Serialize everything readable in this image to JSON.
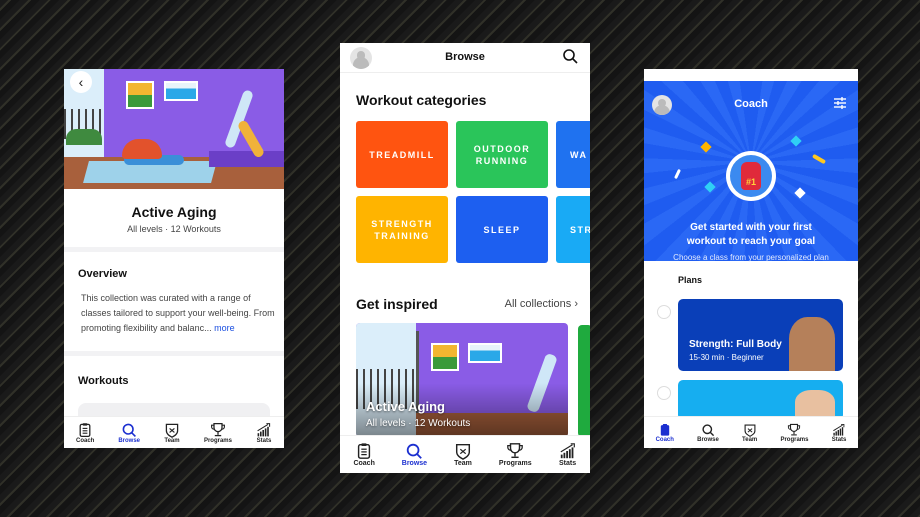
{
  "tabs": [
    {
      "label": "Coach",
      "icon": "clipboard-icon"
    },
    {
      "label": "Browse",
      "icon": "search-icon"
    },
    {
      "label": "Team",
      "icon": "team-shield-icon"
    },
    {
      "label": "Programs",
      "icon": "trophy-icon"
    },
    {
      "label": "Stats",
      "icon": "stats-chart-icon"
    }
  ],
  "collection": {
    "title": "Active Aging",
    "subtitle": "All levels · 12 Workouts",
    "overview_heading": "Overview",
    "overview_text": "This collection was curated with a range of classes tailored to support your well-being. From promoting flexibility and balanc...",
    "more_link": "more",
    "workouts_heading": "Workouts",
    "active_tab": "Browse"
  },
  "browse": {
    "header_title": "Browse",
    "categories_heading": "Workout categories",
    "categories": [
      {
        "label": "TREADMILL",
        "color": "#ff5410"
      },
      {
        "label": "OUTDOOR RUNNING",
        "color": "#2ac55a"
      },
      {
        "label": "WA",
        "color": "#1f72f0"
      },
      {
        "label": "STRENGTH TRAINING",
        "color": "#ffb400"
      },
      {
        "label": "SLEEP",
        "color": "#1d5ff0"
      },
      {
        "label": "STR",
        "color": "#19aaf5"
      }
    ],
    "inspired_heading": "Get inspired",
    "all_collections": "All collections",
    "featured": {
      "title": "Active Aging",
      "subtitle": "All levels · 12 Workouts"
    },
    "active_tab": "Browse"
  },
  "coach": {
    "header_title": "Coach",
    "headline": "Get started with your first workout to reach your goal",
    "subline": "Choose a class from your personalized plan",
    "plans_heading": "Plans",
    "plans": [
      {
        "title": "Strength: Full Body",
        "subtitle": "15-30 min · Beginner",
        "color": "#0a3fb8"
      },
      {
        "title": "",
        "subtitle": "",
        "color": "#16aef0"
      }
    ],
    "active_tab": "Coach"
  },
  "colors": {
    "accent": "#1b2fd0",
    "coach_blue": "#1f5cf0"
  }
}
